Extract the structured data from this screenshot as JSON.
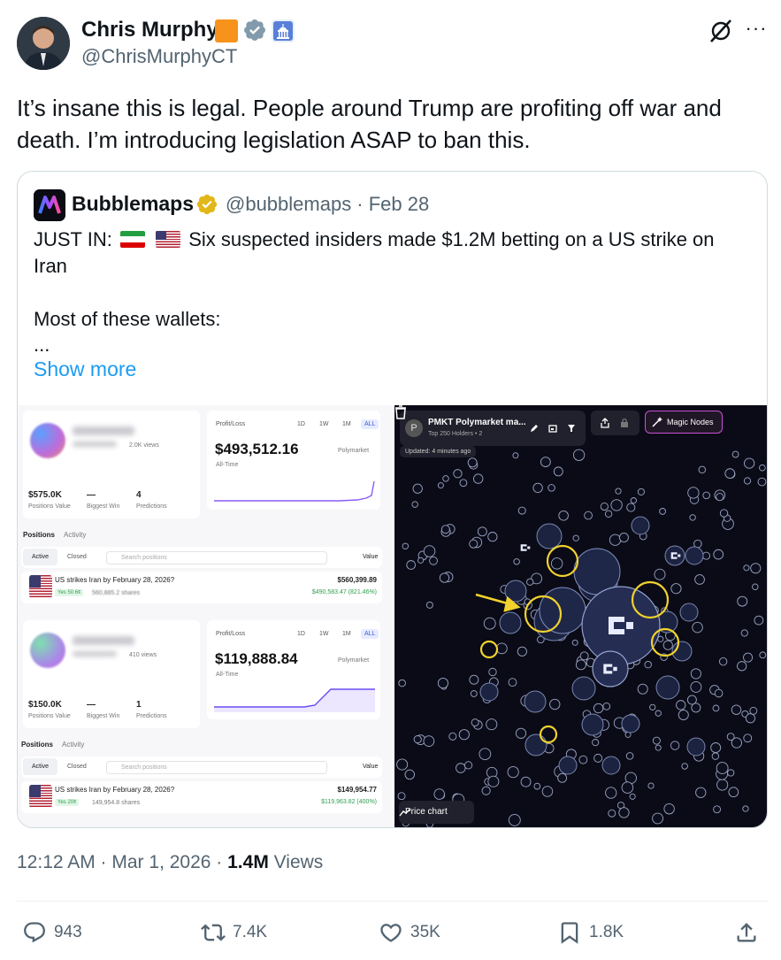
{
  "author": {
    "name": "Chris Murphy",
    "handle": "@ChrisMurphyCT"
  },
  "tweet_text": "It’s insane this is legal. People around Trump are profiting off war and death. I’m introducing legislation ASAP to ban this.",
  "quote": {
    "name": "Bubblemaps",
    "handle_date": "@bubblemaps · Feb 28",
    "line1_prefix": "JUST IN:",
    "line1_rest": "Six suspected insiders made $1.2M betting on a US strike on Iran",
    "line2": "Most of these wallets:",
    "line3": "...",
    "show_more": "Show more"
  },
  "screenshot_left": {
    "profiles": [
      {
        "views": "2.0K views",
        "pl_label": "Profit/Loss",
        "range_tabs": [
          "1D",
          "1W",
          "1M",
          "ALL"
        ],
        "pl_value": "$493,512.16",
        "pl_source": "Polymarket",
        "pl_sub": "All-Time",
        "stat1_value": "$575.0K",
        "stat1_label": "Positions Value",
        "stat2_value": "—",
        "stat2_label": "Biggest Win",
        "stat3_value": "4",
        "stat3_label": "Predictions",
        "tab_positions": "Positions",
        "tab_activity": "Activity",
        "sub_active": "Active",
        "sub_closed": "Closed",
        "search_placeholder": "Search positions",
        "sort_label": "Value",
        "row_title": "US strikes Iran by February 28, 2026?",
        "row_pill": "Yes 50.6¢",
        "row_shares": "560,885.2 shares",
        "row_value": "$560,399.89",
        "row_gain": "$490,583.47 (821.46%)"
      },
      {
        "views": "410 views",
        "pl_label": "Profit/Loss",
        "range_tabs": [
          "1D",
          "1W",
          "1M",
          "ALL"
        ],
        "pl_value": "$119,888.84",
        "pl_source": "Polymarket",
        "pl_sub": "All-Time",
        "stat1_value": "$150.0K",
        "stat1_label": "Positions Value",
        "stat2_value": "—",
        "stat2_label": "Biggest Win",
        "stat3_value": "1",
        "stat3_label": "Predictions",
        "tab_positions": "Positions",
        "tab_activity": "Activity",
        "sub_active": "Active",
        "sub_closed": "Closed",
        "search_placeholder": "Search positions",
        "sort_label": "Value",
        "row_title": "US strikes Iran by February 28, 2026?",
        "row_pill": "Yes 20¢",
        "row_shares": "149,954.8 shares",
        "row_value": "$149,954.77",
        "row_gain": "$119,963.82 (400%)"
      }
    ]
  },
  "bubblemap": {
    "title": "PMKT Polymarket ma...",
    "subtitle": "Top 250 Holders • 2",
    "updated": "Updated: 4 minutes ago",
    "magic_nodes": "Magic Nodes",
    "price_chart": "Price chart"
  },
  "meta": {
    "time_date": "12:12 AM · Mar 1, 2026 · ",
    "views_count": "1.4M",
    "views_label": " Views"
  },
  "actions": {
    "replies": "943",
    "reposts": "7.4K",
    "likes": "35K",
    "bookmarks": "1.8K"
  },
  "colors": {
    "accent": "#1d9bf0",
    "muted": "#536471",
    "highlight_ring": "#f2d22e"
  }
}
